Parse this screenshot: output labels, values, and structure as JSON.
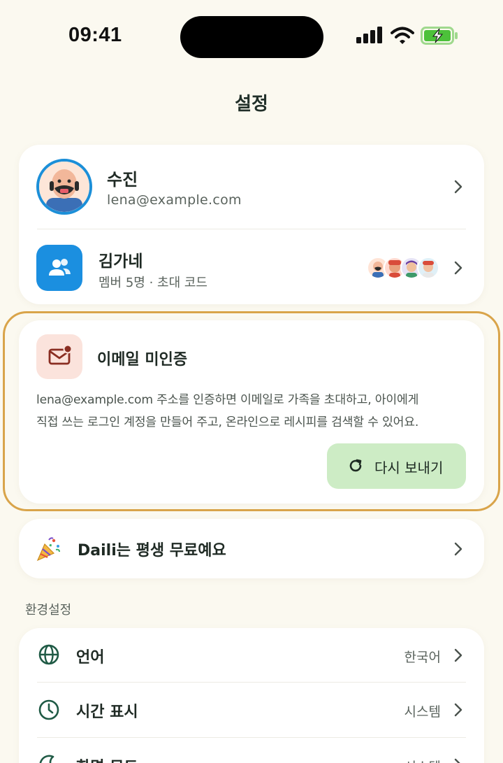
{
  "status_bar": {
    "time": "09:41"
  },
  "header": {
    "title": "설정"
  },
  "profile": {
    "name": "수진",
    "email": "lena@example.com"
  },
  "family": {
    "name": "김가네",
    "subtitle": "멤버 5명 · 초대 코드"
  },
  "email_verification": {
    "title": "이메일 미인증",
    "body_line1": "lena@example.com 주소를 인증하면 이메일로 가족을 초대하고, 아이에게",
    "body_line2": "직접 쓰는 로그인 계정을 만들어 주고, 온라인으로 레시피를 검색할 수 있어요.",
    "resend_label": "다시 보내기"
  },
  "free_banner": {
    "label": "Daili는 평생 무료예요"
  },
  "preferences": {
    "section_title": "환경설정",
    "items": [
      {
        "label": "언어",
        "value": "한국어",
        "icon": "globe-icon"
      },
      {
        "label": "시간 표시",
        "value": "시스템",
        "icon": "clock-icon"
      },
      {
        "label": "화면 모드",
        "value": "시스템",
        "icon": "moon-icon"
      }
    ]
  },
  "colors": {
    "background": "#fbf9f0",
    "accent_blue": "#1b8fe0",
    "highlight_border": "#d9a44a",
    "resend_button": "#cdecc5",
    "icon_green": "#1f5a45"
  }
}
